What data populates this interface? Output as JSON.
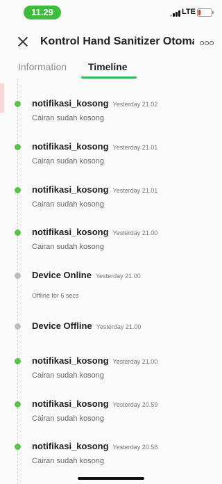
{
  "status_bar": {
    "time": "11.29",
    "network": "LTE"
  },
  "header": {
    "title": "Kontrol Hand Sanitizer Otoma..."
  },
  "tabs": [
    {
      "label": "Information",
      "active": false
    },
    {
      "label": "Timeline",
      "active": true
    }
  ],
  "colors": {
    "accent": "#2ebd55",
    "status_pill": "#3dbd3d",
    "event_active": "#5ac24a",
    "event_device": "#bdbdbd"
  },
  "events": [
    {
      "title": "notifikasi_kosong",
      "time": "Yesterday 21.02",
      "desc": "Cairan sudah kosong",
      "dot": "green"
    },
    {
      "title": "notifikasi_kosong",
      "time": "Yesterday 21.01",
      "desc": "Cairan sudah kosong",
      "dot": "green"
    },
    {
      "title": "notifikasi_kosong",
      "time": "Yesterday 21.01",
      "desc": "Cairan sudah kosong",
      "dot": "green"
    },
    {
      "title": "notifikasi_kosong",
      "time": "Yesterday 21.00",
      "desc": "Cairan sudah kosong",
      "dot": "green"
    },
    {
      "title": "Device Online",
      "time": "Yesterday 21.00",
      "desc": "Offline for 6 secs",
      "dot": "gray"
    },
    {
      "title": "Device Offline",
      "time": "Yesterday 21.00",
      "desc": "",
      "dot": "gray"
    },
    {
      "title": "notifikasi_kosong",
      "time": "Yesterday 21.00",
      "desc": "Cairan sudah kosong",
      "dot": "green"
    },
    {
      "title": "notifikasi_kosong",
      "time": "Yesterday 20.59",
      "desc": "Cairan sudah kosong",
      "dot": "green"
    },
    {
      "title": "notifikasi_kosong",
      "time": "Yesterday 20.58",
      "desc": "Cairan sudah kosong",
      "dot": "green"
    }
  ]
}
